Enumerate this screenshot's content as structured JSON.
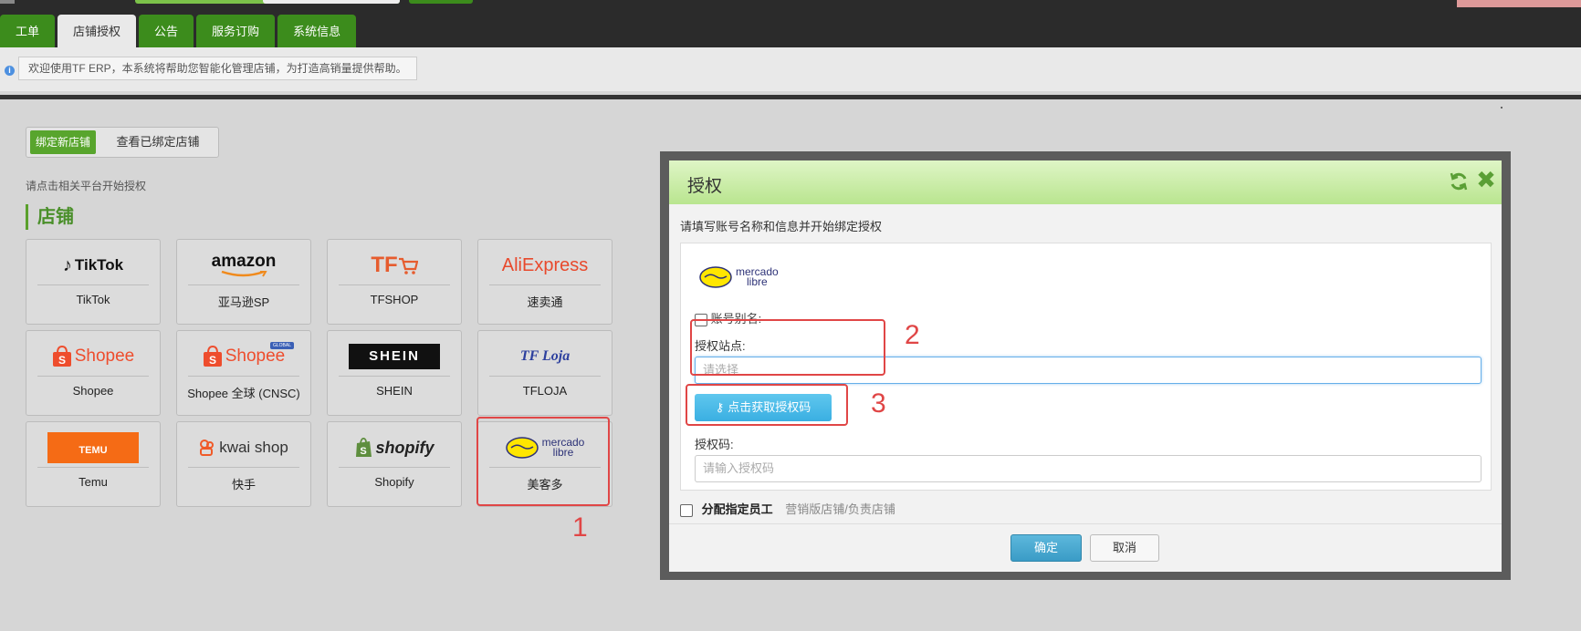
{
  "top_tabs": [
    {
      "label": "工单"
    },
    {
      "label": "店铺授权"
    },
    {
      "label": "公告"
    },
    {
      "label": "服务订购"
    },
    {
      "label": "系统信息"
    }
  ],
  "notice": "欢迎使用TF ERP，本系统将帮助您智能化管理店铺，为打造高销量提供帮助。",
  "segment": {
    "bind_new": "绑定新店铺",
    "view_bound": "查看已绑定店铺"
  },
  "hint": "请点击相关平台开始授权",
  "section_title": "店铺",
  "platforms": [
    {
      "logo": "TikTok",
      "label": "TikTok"
    },
    {
      "logo": "amazon",
      "label": "亚马逊SP"
    },
    {
      "logo": "TF",
      "label": "TFSHOP"
    },
    {
      "logo": "AliExpress",
      "label": "速卖通"
    },
    {
      "logo": "Shopee",
      "label": "Shopee"
    },
    {
      "logo": "Shopee",
      "badge": "GLOBAL",
      "label": "Shopee 全球 (CNSC)"
    },
    {
      "logo": "SHEIN",
      "label": "SHEIN"
    },
    {
      "logo": "TF Loja",
      "label": "TFLOJA"
    },
    {
      "logo": "TEMU",
      "label": "Temu"
    },
    {
      "logo": "kwai shop",
      "label": "快手"
    },
    {
      "logo": "shopify",
      "label": "Shopify"
    },
    {
      "logo_line1": "mercado",
      "logo_line2": "libre",
      "label": "美客多"
    }
  ],
  "annotations": [
    "1",
    "2",
    "3"
  ],
  "modal": {
    "title": "授权",
    "subtitle": "请填写账号名称和信息并开始绑定授权",
    "logo_line1": "mercado",
    "logo_line2": "libre",
    "alias_label": "账号别名:",
    "site_label": "授权站点:",
    "site_placeholder": "请选择",
    "get_code_button": "点击获取授权码",
    "code_label": "授权码:",
    "code_placeholder": "请输入授权码",
    "assign_label": "分配指定员工",
    "assign_sub": "营销版店铺/负责店铺",
    "ok": "确定",
    "cancel": "取消"
  },
  "colors": {
    "green": "#3c8c1c",
    "accent_blue": "#3aafe2",
    "annotation_red": "#e04646"
  }
}
